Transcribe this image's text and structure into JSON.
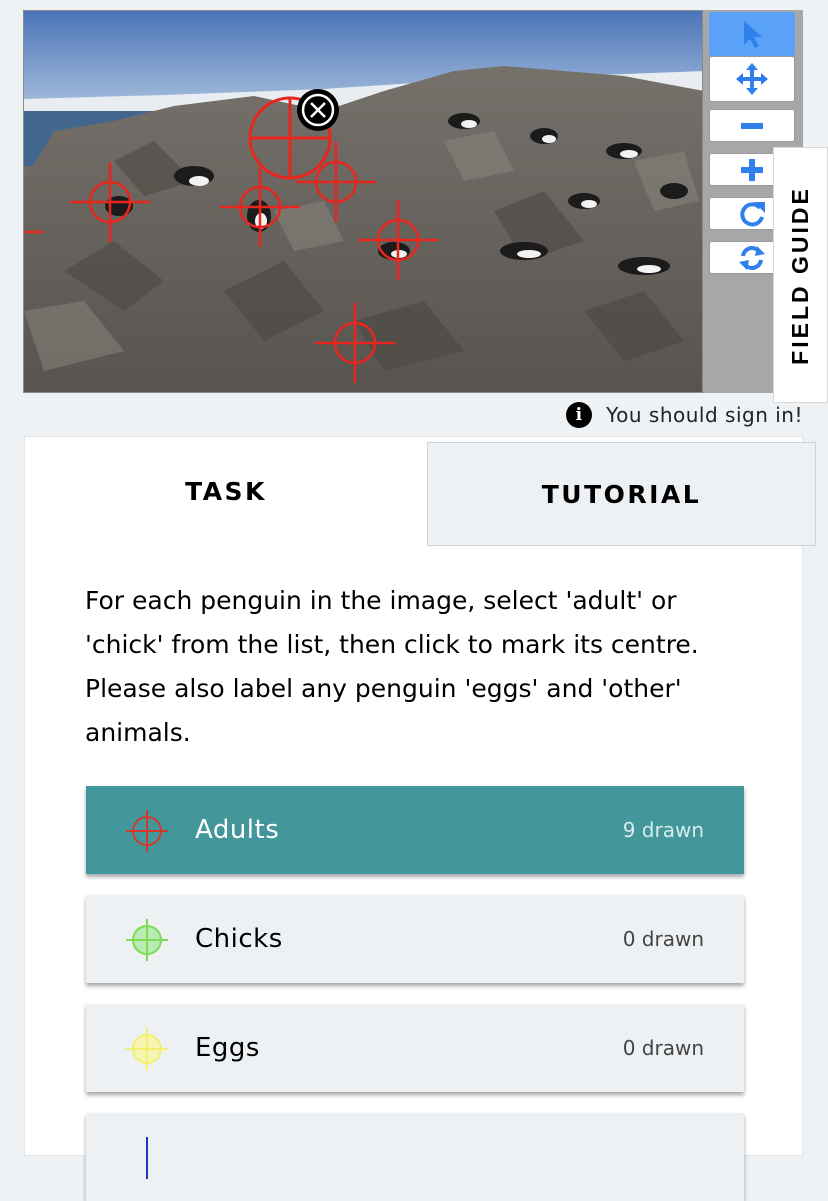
{
  "toolbar": {
    "tools": [
      {
        "name": "select-tool",
        "icon": "pointer-arrow-icon",
        "active": true
      },
      {
        "name": "pan-tool",
        "icon": "move-arrows-icon",
        "active": false
      },
      {
        "name": "zoom-out-tool",
        "icon": "minus-icon",
        "active": false
      },
      {
        "name": "zoom-in-tool",
        "icon": "plus-icon",
        "active": false
      },
      {
        "name": "rotate-tool",
        "icon": "rotate-icon",
        "active": false
      },
      {
        "name": "reset-tool",
        "icon": "refresh-icon",
        "active": false
      }
    ],
    "icon_color": "#2f80ed"
  },
  "field_guide": {
    "label": "FIELD GUIDE"
  },
  "signin": {
    "icon": "info-icon",
    "text": "You should sign in!"
  },
  "tabs": {
    "task": "TASK",
    "tutorial": "TUTORIAL",
    "active": "TASK"
  },
  "task": {
    "instructions": "For each penguin in the image, select 'adult' or 'chick' from the list, then click to mark its centre. Please also label any penguin 'eggs' and 'other' animals.",
    "choices": [
      {
        "label": "Adults",
        "count": "9 drawn",
        "color": "#d0392b",
        "selected": true
      },
      {
        "label": "Chicks",
        "count": "0 drawn",
        "color": "#7ed957",
        "selected": false
      },
      {
        "label": "Eggs",
        "count": "0 drawn",
        "color": "#f2f06e",
        "selected": false
      },
      {
        "label": "",
        "count": "",
        "color": "#2233cc",
        "selected": false
      }
    ]
  },
  "colors": {
    "accent": "#43979a",
    "marker": "#e8261d",
    "toolbar_active": "#5aa2f7"
  }
}
